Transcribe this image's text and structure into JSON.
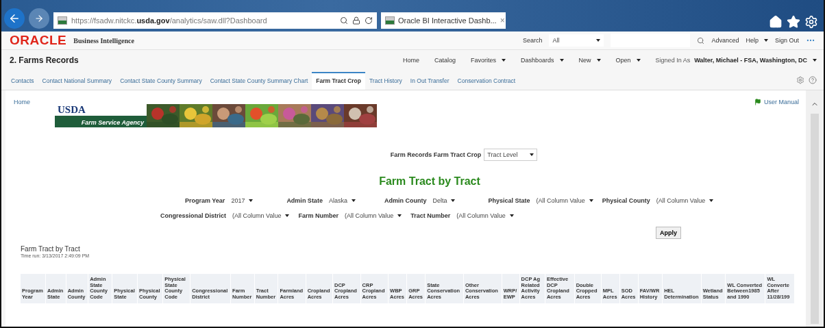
{
  "browser": {
    "url": "https://fsadw.nitckc.**usda.gov**/analytics/saw.dll?Dashboard",
    "tab_title": "Oracle BI Interactive Dashb...",
    "tab_close": "×"
  },
  "oracle_header": {
    "logo": "ORACLE",
    "product": "Business Intelligence",
    "search_label": "Search",
    "search_scope": "All",
    "links": [
      {
        "label": "Advanced",
        "has_menu": false
      },
      {
        "label": "Help",
        "has_menu": true
      },
      {
        "label": "Sign Out",
        "has_menu": false
      }
    ]
  },
  "page_title": "2. Farms Records",
  "nav": [
    {
      "label": "Home",
      "has_menu": false
    },
    {
      "label": "Catalog",
      "has_menu": false
    },
    {
      "label": "Favorites",
      "has_menu": true
    },
    {
      "label": "Dashboards",
      "has_menu": true
    },
    {
      "label": "New",
      "has_menu": true
    },
    {
      "label": "Open",
      "has_menu": true
    }
  ],
  "signed_in": {
    "label": "Signed In As",
    "user": "Walter, Michael - FSA, Washington, DC"
  },
  "tabs": [
    {
      "label": "Contacts",
      "selected": false
    },
    {
      "label": "Contact National Summary",
      "selected": false
    },
    {
      "label": "Contact State County Summary",
      "selected": false
    },
    {
      "label": "Contact State County Summary Chart",
      "selected": false
    },
    {
      "label": "Farm Tract Crop",
      "selected": true
    },
    {
      "label": "Tract History",
      "selected": false
    },
    {
      "label": "In Out Transfer",
      "selected": false
    },
    {
      "label": "Conservation Contract",
      "selected": false
    }
  ],
  "content": {
    "home_link": "Home",
    "banner": {
      "agency_logo": "USDA",
      "agency_name": "Farm Service Agency"
    },
    "user_manual": "User Manual",
    "view_selector": {
      "label": "Farm Records Farm Tract Crop",
      "value": "Tract Level"
    },
    "title": "Farm Tract by Tract",
    "filter_rows": [
      [
        {
          "label": "Program Year",
          "value": "2017"
        },
        {
          "label": "Admin State",
          "value": "Alaska"
        },
        {
          "label": "Admin County",
          "value": "Delta"
        },
        {
          "label": "Physical State",
          "value": "(All Column Value"
        },
        {
          "label": "Physical County",
          "value": "(All Column Value"
        }
      ],
      [
        {
          "label": "Congressional District",
          "value": "(All Column Value"
        },
        {
          "label": "Farm Number",
          "value": "(All Column Value"
        },
        {
          "label": "Tract Number",
          "value": "(All Column Value"
        }
      ]
    ],
    "apply": "Apply",
    "report": {
      "title": "Farm Tract by Tract",
      "time_run": "Time run: 3/13/2017 2:49:09 PM"
    },
    "table": {
      "columns": [
        "Program Year",
        "Admin State",
        "Admin County",
        "Admin State County Code",
        "Physical State",
        "Physical County",
        "Physical State County Code",
        "Congressional District",
        "Farm Number",
        "Tract Number",
        "Farmland Acres",
        "Cropland Acres",
        "DCP Cropland Acres",
        "CRP Cropland Acres",
        "WBP Acres",
        "GRP Acres",
        "State Conservation Acres",
        "Other Conservation Acres",
        "WRP/ EWP",
        "DCP Ag Related Activity Acres",
        "Effective DCP Cropland Acres",
        "Double Cropped Acres",
        "MPL Acres",
        "SOD Acres",
        "FAV/WR History",
        "HEL Determination",
        "Wetland Status",
        "WL Converted Between1985 and 1990",
        "WL Converte After 11/28/199"
      ]
    }
  }
}
